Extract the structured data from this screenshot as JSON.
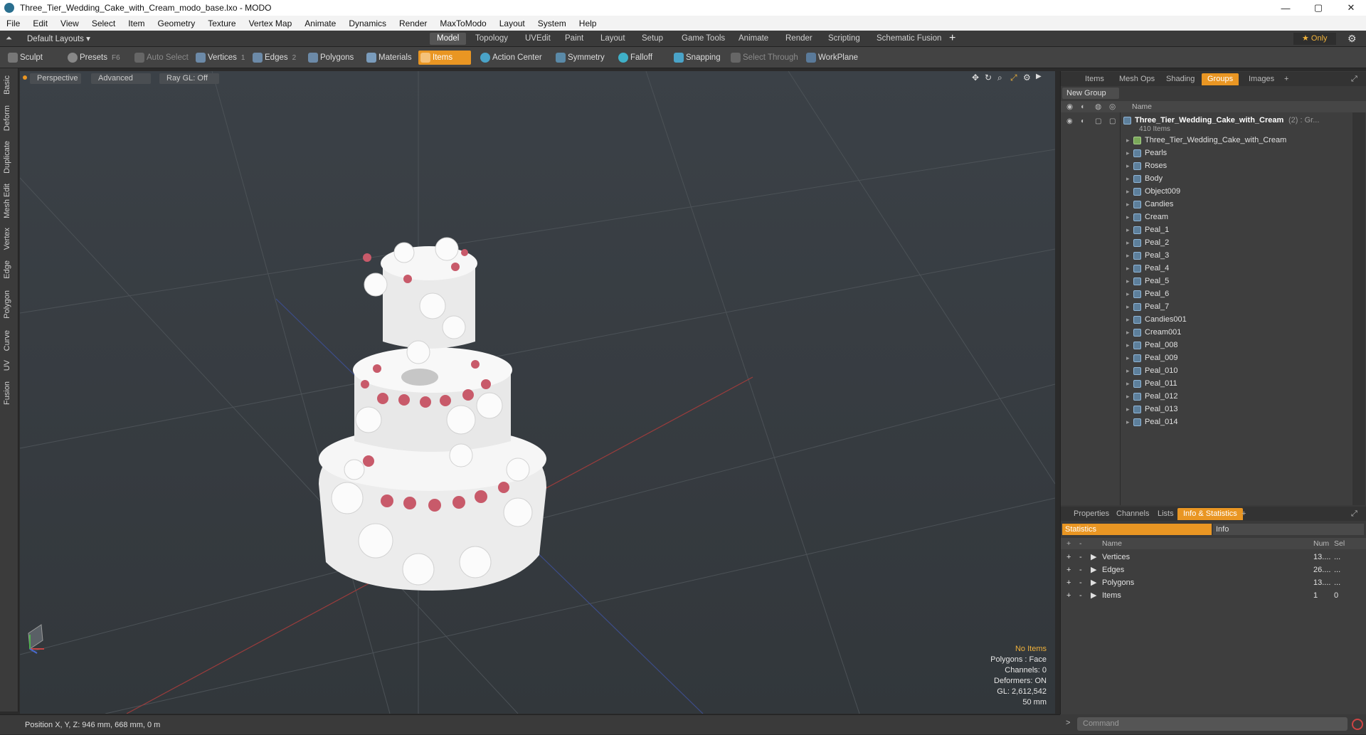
{
  "window": {
    "title": "Three_Tier_Wedding_Cake_with_Cream_modo_base.lxo - MODO",
    "minimize": "—",
    "maximize": "▢",
    "close": "✕"
  },
  "menu": [
    "File",
    "Edit",
    "View",
    "Select",
    "Item",
    "Geometry",
    "Texture",
    "Vertex Map",
    "Animate",
    "Dynamics",
    "Render",
    "MaxToModo",
    "Layout",
    "System",
    "Help"
  ],
  "modebar": {
    "layout_label": "Default Layouts ▾",
    "tabs": [
      "Model",
      "Topology",
      "UVEdit",
      "Paint",
      "Layout",
      "Setup",
      "Game Tools",
      "Animate",
      "Render",
      "Scripting",
      "Schematic Fusion"
    ],
    "active_tab": "Model",
    "add": "+",
    "only": "★ Only"
  },
  "toolbar": {
    "sculpt": "Sculpt",
    "presets": "Presets",
    "presets_key": "F6",
    "auto_select": "Auto Select",
    "vertices": "Vertices",
    "vertices_key": "1",
    "edges": "Edges",
    "edges_key": "2",
    "polygons": "Polygons",
    "materials": "Materials",
    "items": "Items",
    "action_center": "Action Center",
    "symmetry": "Symmetry",
    "falloff": "Falloff",
    "snapping": "Snapping",
    "select_through": "Select Through",
    "workplane": "WorkPlane"
  },
  "left_tabs": [
    "Basic",
    "Deform",
    "Duplicate",
    "Mesh Edit",
    "Vertex",
    "Edge",
    "Polygon",
    "Curve",
    "UV",
    "Fusion"
  ],
  "viewport": {
    "view": "Perspective",
    "shading": "Advanced",
    "raygl": "Ray GL: Off",
    "info": {
      "selection": "No Items",
      "polygons": "Polygons : Face",
      "channels": "Channels: 0",
      "deformers": "Deformers: ON",
      "gl": "GL: 2,612,542",
      "scale": "50 mm"
    }
  },
  "status": {
    "position": "Position X, Y, Z:  946 mm, 668 mm, 0 m"
  },
  "groups_panel": {
    "tabs": [
      "Items",
      "Mesh Ops",
      "Shading",
      "Groups",
      "Images"
    ],
    "active_tab": "Groups",
    "new_group": "New Group",
    "col_name": "Name",
    "root": {
      "name": "Three_Tier_Wedding_Cake_with_Cream",
      "suffix": "(2) : Gr...",
      "count": "410 Items"
    },
    "items": [
      "Three_Tier_Wedding_Cake_with_Cream",
      "Pearls",
      "Roses",
      "Body",
      "Object009",
      "Candies",
      "Cream",
      "Peal_1",
      "Peal_2",
      "Peal_3",
      "Peal_4",
      "Peal_5",
      "Peal_6",
      "Peal_7",
      "Candies001",
      "Cream001",
      "Peal_008",
      "Peal_009",
      "Peal_010",
      "Peal_011",
      "Peal_012",
      "Peal_013",
      "Peal_014"
    ]
  },
  "stats_panel": {
    "tabs": [
      "Properties",
      "Channels",
      "Lists",
      "Info & Statistics"
    ],
    "active_tab": "Info & Statistics",
    "sub_tabs": [
      "Statistics",
      "Info"
    ],
    "cols": {
      "name": "Name",
      "num": "Num",
      "sel": "Sel"
    },
    "rows": [
      {
        "name": "Vertices",
        "num": "13....",
        "sel": "..."
      },
      {
        "name": "Edges",
        "num": "26....",
        "sel": "..."
      },
      {
        "name": "Polygons",
        "num": "13....",
        "sel": "..."
      },
      {
        "name": "Items",
        "num": "1",
        "sel": "0"
      }
    ]
  },
  "command": {
    "placeholder": "Command"
  },
  "colors": {
    "accent": "#e99623",
    "background": "#3a3a3a"
  }
}
